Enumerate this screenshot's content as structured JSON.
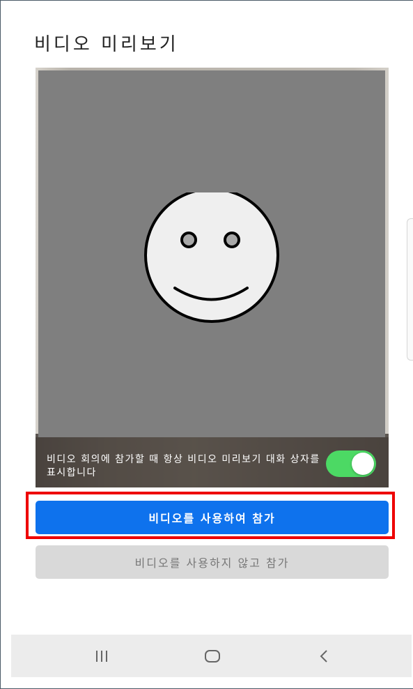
{
  "dialog": {
    "title": "비디오 미리보기",
    "preview_setting_text": "비디오 회의에 참가할 때 항상 비디오 미리보기 대화 상자를 표시합니다",
    "preview_setting_enabled": true,
    "join_with_video_label": "비디오를 사용하여 참가",
    "join_without_video_label": "비디오를 사용하지 않고 참가"
  },
  "nav": {
    "recent_icon": "recent-apps-icon",
    "home_icon": "home-icon",
    "back_icon": "back-icon"
  },
  "colors": {
    "primary": "#0e72ed",
    "toggle_on": "#4cd964",
    "secondary_button": "#d9d9d9",
    "highlight": "#ee0000",
    "video_tile": "#7f7f7f"
  }
}
